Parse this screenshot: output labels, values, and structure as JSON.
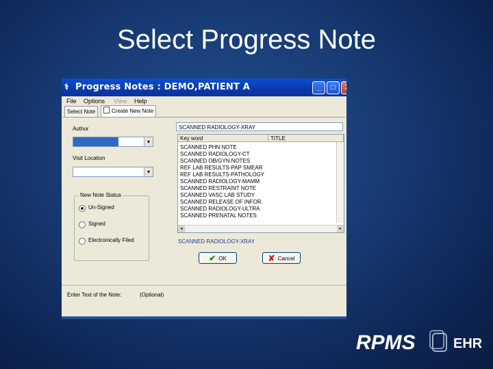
{
  "slide": {
    "title": "Select Progress Note"
  },
  "window": {
    "title": "Progress Notes : DEMO,PATIENT A",
    "controls": {
      "minimize": "_",
      "maximize": "□",
      "close": "X"
    }
  },
  "menu": [
    "File",
    "Options",
    "View",
    "Help"
  ],
  "tabs": {
    "select_note": "Select Note",
    "create_new_note": "Create New Note"
  },
  "form": {
    "author_label": "Author",
    "visit_location_label": "Visit Location",
    "status_group": {
      "label": "New Note Status",
      "options": [
        "Un-Signed",
        "Signed",
        "Electronically Filed"
      ],
      "selected": "Un-Signed"
    },
    "title_input_value": "SCANNED RADIOLOGY-XRAY",
    "columns": {
      "keyword": "Key word",
      "title": "TITLE"
    },
    "notes": [
      "SCANNED PHN NOTE",
      "SCANNED RADIOLOGY-CT",
      "SCANNED OB/GYN NOTES",
      "REF LAB RESULTS-PAP SMEAR",
      "REF LAB RESULTS-PATHOLOGY",
      "SCANNED RADIOLOGY-MAMM",
      "SCANNED RESTRAINT NOTE",
      "SCANNED VASC LAB STUDY",
      "SCANNED RELEASE OF INFOR.",
      "SCANNED RADIOLOGY-ULTRA",
      "SCANNED PRENATAL NOTES"
    ],
    "selected_title": "SCANNED RADIOLOGY-XRAY",
    "ok_label": "OK",
    "cancel_label": "Cancel"
  },
  "status_bar": {
    "enter_text": "Enter Text of the Note:",
    "optional": "(Optional)"
  },
  "logo": {
    "text": "RPMS",
    "suffix": "EHR"
  },
  "colors": {
    "title_bar": "#0a3aa8",
    "selection": "#316ac5",
    "background": "#173a73"
  }
}
